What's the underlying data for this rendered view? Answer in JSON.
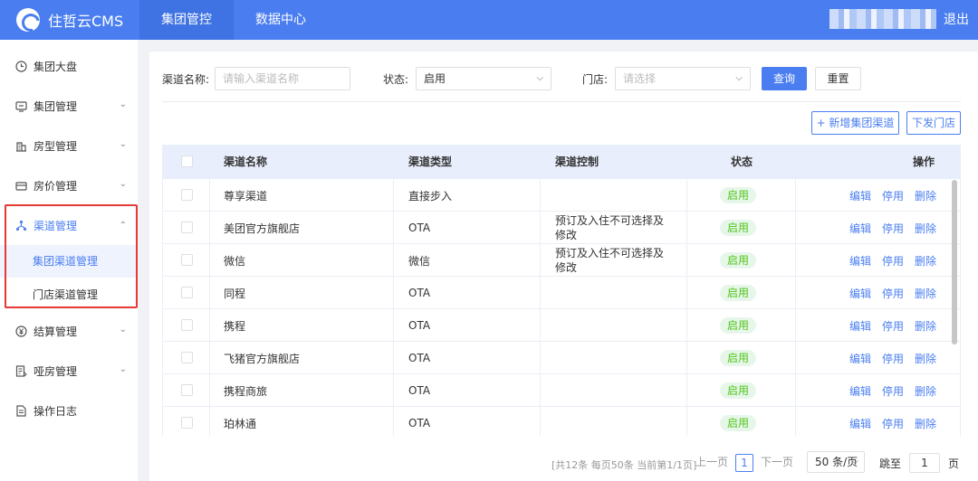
{
  "app": {
    "logo_text": "住哲云CMS",
    "logout": "退出"
  },
  "topnav": [
    {
      "label": "集团管控",
      "active": true
    },
    {
      "label": "数据中心",
      "active": false
    }
  ],
  "sidebar": {
    "items": [
      {
        "label": "集团大盘",
        "icon": "clock-icon"
      },
      {
        "label": "集团管理",
        "icon": "monitor-icon"
      },
      {
        "label": "房型管理",
        "icon": "building-icon"
      },
      {
        "label": "房价管理",
        "icon": "wallet-icon"
      },
      {
        "label": "渠道管理",
        "icon": "network-icon"
      },
      {
        "label": "结算管理",
        "icon": "yen-icon"
      },
      {
        "label": "哑房管理",
        "icon": "document-list-icon"
      },
      {
        "label": "操作日志",
        "icon": "log-icon"
      }
    ],
    "sub_items": [
      {
        "label": "集团渠道管理"
      },
      {
        "label": "门店渠道管理"
      }
    ]
  },
  "filters": {
    "channel_name_label": "渠道名称:",
    "channel_name_placeholder": "请输入渠道名称",
    "status_label": "状态:",
    "status_value": "启用",
    "store_label": "门店:",
    "store_placeholder": "请选择",
    "query_button": "查询",
    "reset_button": "重置"
  },
  "actions": {
    "add_group_channel": "+ 新增集团渠道",
    "dispatch_store": "下发门店"
  },
  "table": {
    "columns": [
      "渠道名称",
      "渠道类型",
      "渠道控制",
      "状态",
      "操作"
    ],
    "rows": [
      {
        "name": "尊享渠道",
        "type": "直接步入",
        "control": "",
        "status": "启用"
      },
      {
        "name": "美团官方旗舰店",
        "type": "OTA",
        "control": "预订及入住不可选择及修改",
        "status": "启用"
      },
      {
        "name": "微信",
        "type": "微信",
        "control": "预订及入住不可选择及修改",
        "status": "启用"
      },
      {
        "name": "同程",
        "type": "OTA",
        "control": "",
        "status": "启用"
      },
      {
        "name": "携程",
        "type": "OTA",
        "control": "",
        "status": "启用"
      },
      {
        "name": "飞猪官方旗舰店",
        "type": "OTA",
        "control": "",
        "status": "启用"
      },
      {
        "name": "携程商旅",
        "type": "OTA",
        "control": "",
        "status": "启用"
      },
      {
        "name": "珀林通",
        "type": "OTA",
        "control": "",
        "status": "启用"
      }
    ],
    "ops": {
      "edit": "编辑",
      "disable": "停用",
      "delete": "删除"
    }
  },
  "pagination": {
    "info": "[共12条 每页50条 当前第1/1页]",
    "prev": "上一页",
    "current_page": "1",
    "next": "下一页",
    "page_size": "50 条/页",
    "jump_label": "跳至",
    "jump_value": "1",
    "page_suffix": "页"
  }
}
